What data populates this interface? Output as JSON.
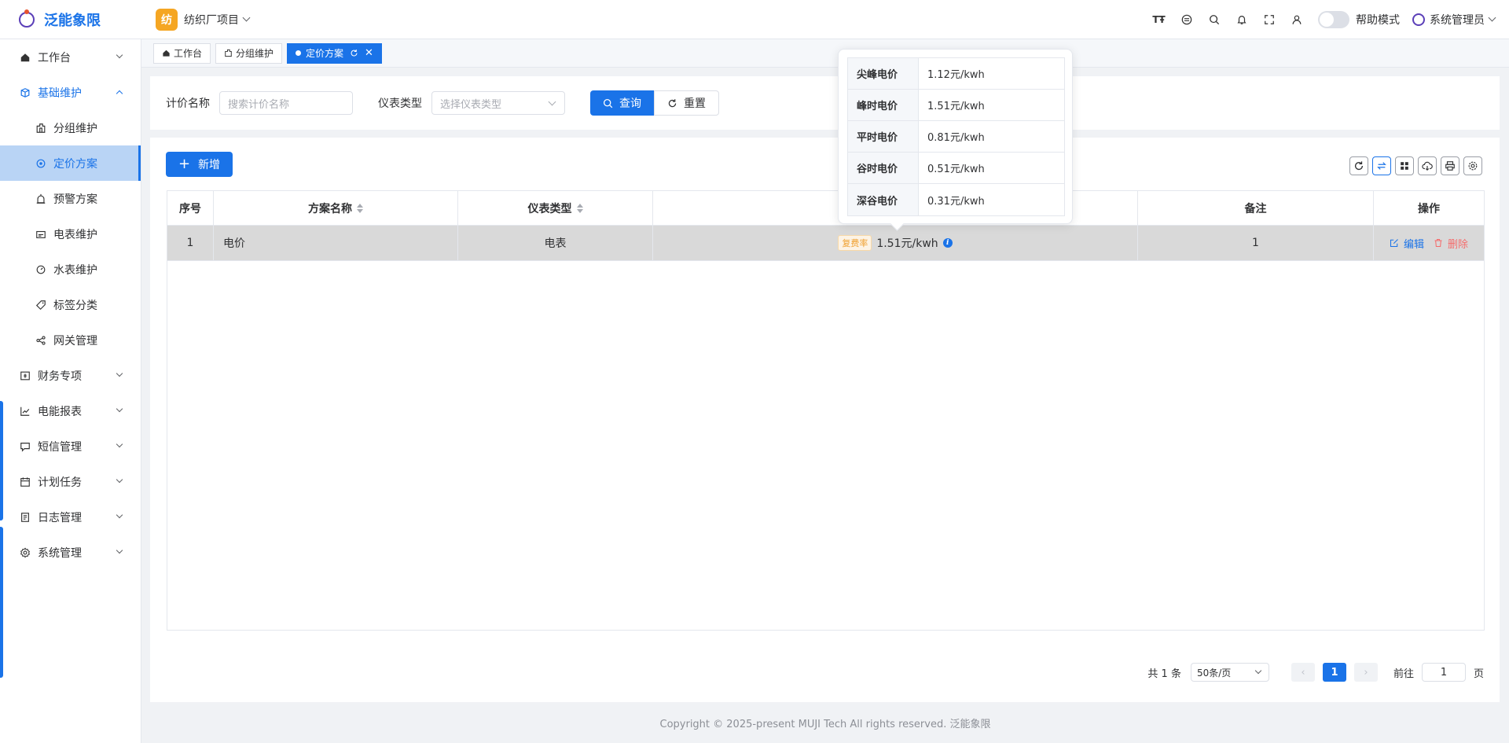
{
  "app": {
    "logo_text": "泛能象限"
  },
  "project": {
    "badge": "纺",
    "name": "纺织厂项目"
  },
  "topbar": {
    "font_icon_text": "TŦ",
    "help_mode_label": "帮助模式",
    "user_name": "系统管理员"
  },
  "sidebar": {
    "items": [
      {
        "label": "工作台"
      },
      {
        "label": "基础维护"
      },
      {
        "label": "分组维护"
      },
      {
        "label": "定价方案"
      },
      {
        "label": "预警方案"
      },
      {
        "label": "电表维护"
      },
      {
        "label": "水表维护"
      },
      {
        "label": "标签分类"
      },
      {
        "label": "网关管理"
      },
      {
        "label": "财务专项"
      },
      {
        "label": "电能报表"
      },
      {
        "label": "短信管理"
      },
      {
        "label": "计划任务"
      },
      {
        "label": "日志管理"
      },
      {
        "label": "系统管理"
      }
    ]
  },
  "tabs": [
    {
      "label": "工作台"
    },
    {
      "label": "分组维护"
    },
    {
      "label": "定价方案"
    }
  ],
  "search": {
    "name_label": "计价名称",
    "name_placeholder": "搜索计价名称",
    "type_label": "仪表类型",
    "type_placeholder": "选择仪表类型",
    "query_label": "查询",
    "reset_label": "重置"
  },
  "toolbar": {
    "add_label": "新增"
  },
  "table": {
    "headers": [
      "序号",
      "方案名称",
      "仪表类型",
      "",
      "备注",
      "操作"
    ],
    "rows": [
      {
        "index": "1",
        "name": "电价",
        "meter_type": "电表",
        "rate_tag": "复费率",
        "price": "1.51元/kwh",
        "remark": "1",
        "edit": "编辑",
        "delete": "删除"
      }
    ]
  },
  "popover": {
    "rows": [
      {
        "k": "尖峰电价",
        "v": "1.12元/kwh"
      },
      {
        "k": "峰时电价",
        "v": "1.51元/kwh"
      },
      {
        "k": "平时电价",
        "v": "0.81元/kwh"
      },
      {
        "k": "谷时电价",
        "v": "0.51元/kwh"
      },
      {
        "k": "深谷电价",
        "v": "0.31元/kwh"
      }
    ]
  },
  "pager": {
    "total": "共 1 条",
    "page_size": "50条/页",
    "prev": "‹",
    "current": "1",
    "next": "›",
    "jump_label": "前往",
    "jump_value": "1",
    "page_unit": "页"
  },
  "footer": {
    "copyright": "Copyright © 2025-present MUJI Tech All rights reserved. 泛能象限"
  },
  "colors": {
    "primary": "#1a73e8",
    "danger": "#f56c6c",
    "warning": "#f0a030",
    "project_badge": "#f5a623"
  }
}
